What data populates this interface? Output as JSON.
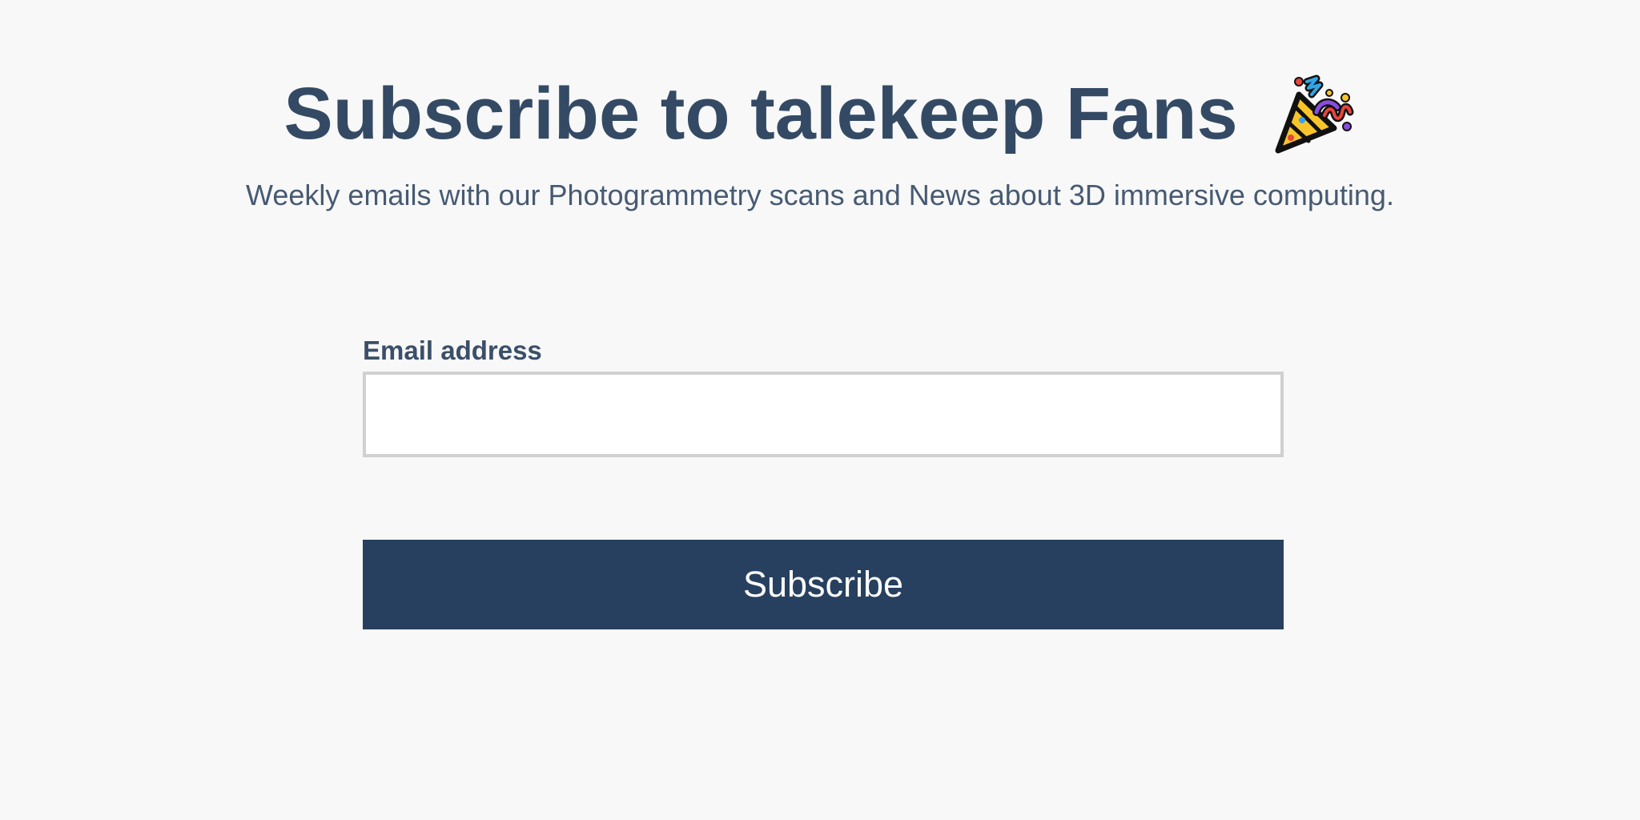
{
  "header": {
    "title": "Subscribe to talekeep Fans",
    "title_icon": "party-popper-icon",
    "subtitle": "Weekly emails with our Photogrammetry scans and News about 3D immersive computing."
  },
  "form": {
    "email_label": "Email address",
    "email_value": "",
    "email_placeholder": "",
    "submit_label": "Subscribe"
  },
  "colors": {
    "background": "#f8f8f8",
    "heading": "#344a64",
    "button": "#27405f",
    "input_border": "#d0d0d0"
  }
}
